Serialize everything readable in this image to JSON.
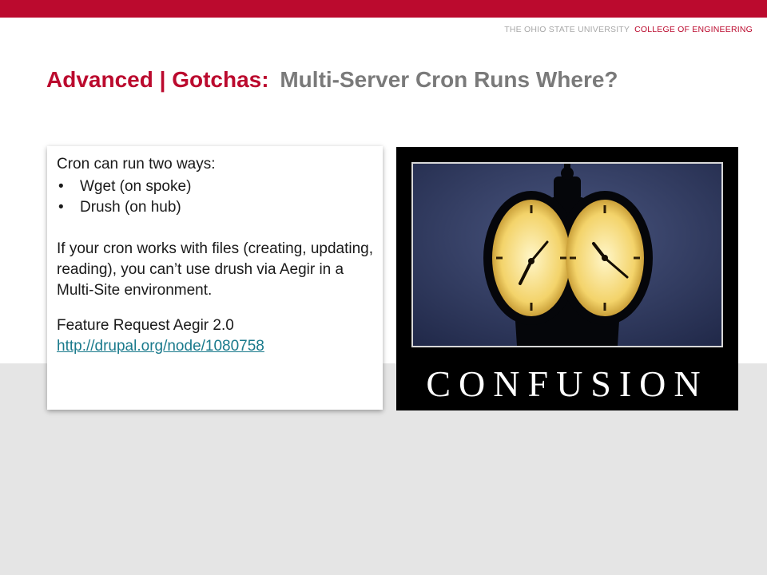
{
  "header": {
    "university": "THE OHIO STATE UNIVERSITY",
    "college": "COLLEGE OF ENGINEERING"
  },
  "title": {
    "accent": "Advanced | Gotchas:",
    "main": "Multi-Server Cron Runs Where?"
  },
  "content": {
    "intro": "Cron can run two ways:",
    "bullets": [
      {
        "marker": "•",
        "text": "Wget (on spoke)"
      },
      {
        "marker": "•",
        "text": "Drush (on hub)"
      }
    ],
    "paragraph": "If your cron works with files (creating, updating, reading), you can’t use drush via Aegir in a Multi-Site environment.",
    "feature_request": "Feature Request Aegir 2.0",
    "link": "http://drupal.org/node/1080758"
  },
  "image": {
    "poster_word": "CONFUSION",
    "icon": "clock-tower-image"
  },
  "colors": {
    "brand_red": "#bb0a2e",
    "title_gray": "#7a7a7a",
    "link_teal": "#1a7a8c",
    "band_gray": "#e5e5e5"
  }
}
